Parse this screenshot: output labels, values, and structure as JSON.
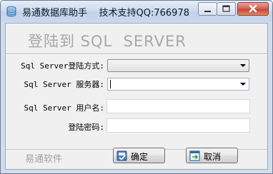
{
  "window": {
    "title": "易通数据库助手    技术支持QQ:766978"
  },
  "form": {
    "heading": "登陆到 SQL  SERVER",
    "login_mode_label": "Sql Server登陆方式:",
    "login_mode_value": "",
    "server_label": "Sql Server 服务器:",
    "server_value": "",
    "username_label": "Sql Server 用户名:",
    "username_value": "",
    "password_label": "登陆密码:",
    "password_value": ""
  },
  "footer": {
    "brand": "易通软件",
    "ok_label": "确定",
    "cancel_label": "取消"
  },
  "icons": {
    "app": "database-icon",
    "ok": "confirm-icon",
    "cancel": "exit-icon"
  }
}
